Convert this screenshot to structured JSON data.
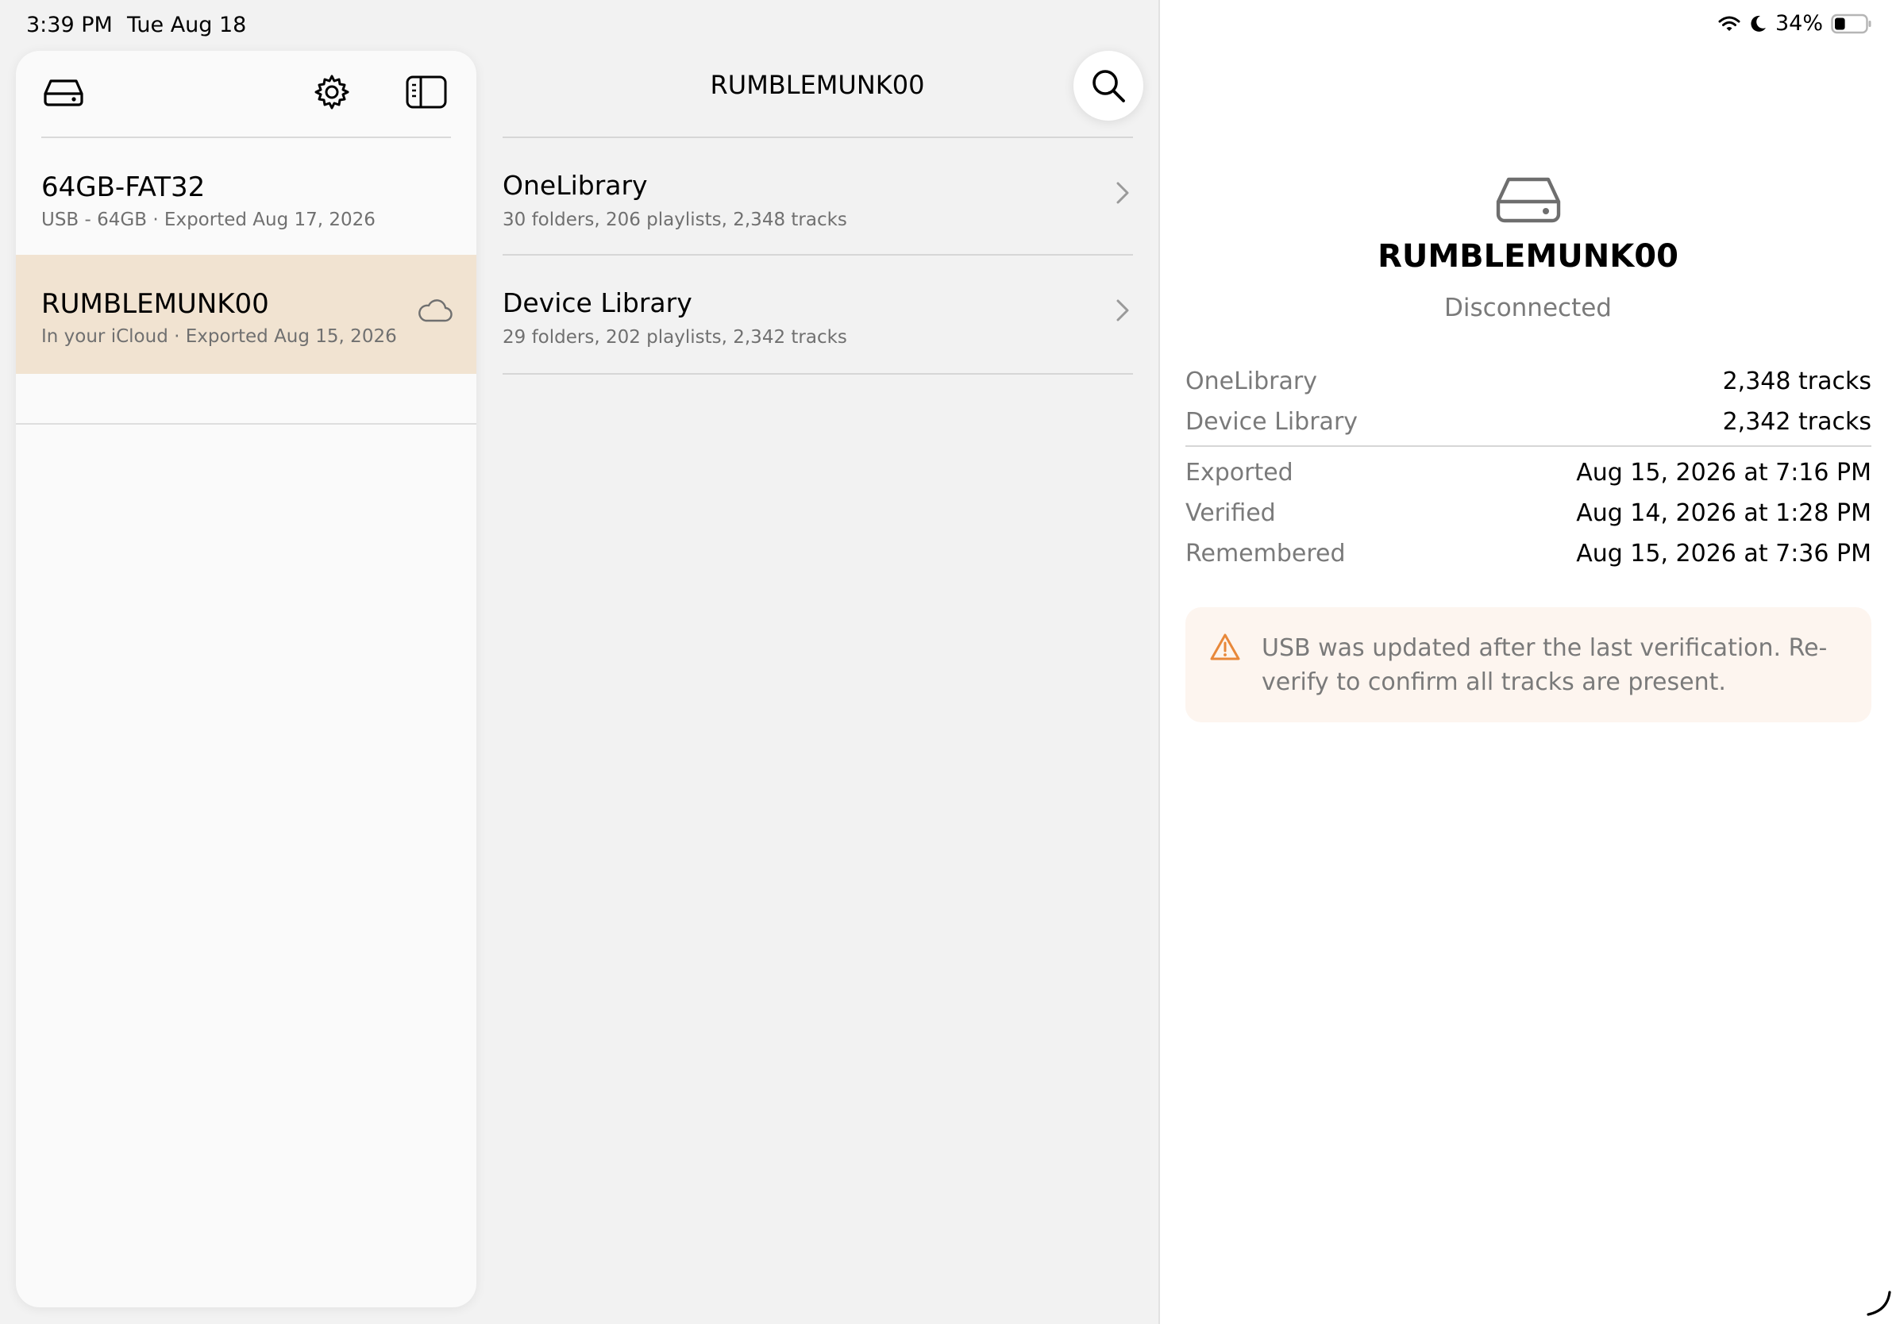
{
  "status_bar": {
    "time": "3:39 PM",
    "date": "Tue Aug 18",
    "battery": "34%",
    "battery_level": 0.34
  },
  "sidebar": {
    "devices": [
      {
        "name": "64GB-FAT32",
        "subtitle": "USB - 64GB · Exported Aug 17, 2026",
        "selected": false
      },
      {
        "name": "RUMBLEMUNK00",
        "subtitle": "In your iCloud · Exported Aug 15, 2026",
        "selected": true,
        "icon": "cloud-icon"
      }
    ]
  },
  "content": {
    "title": "RUMBLEMUNK00",
    "libraries": [
      {
        "name": "OneLibrary",
        "subtitle": "30 folders, 206 playlists, 2,348 tracks"
      },
      {
        "name": "Device Library",
        "subtitle": "29 folders, 202 playlists, 2,342 tracks"
      }
    ]
  },
  "detail": {
    "title": "RUMBLEMUNK00",
    "status": "Disconnected",
    "libraries": [
      {
        "label": "OneLibrary",
        "value": "2,348 tracks"
      },
      {
        "label": "Device Library",
        "value": "2,342 tracks"
      }
    ],
    "dates": [
      {
        "label": "Exported",
        "value": "Aug 15, 2026 at 7:16 PM"
      },
      {
        "label": "Verified",
        "value": "Aug 14, 2026 at 1:28 PM"
      },
      {
        "label": "Remembered",
        "value": "Aug 15, 2026 at 7:36 PM"
      }
    ],
    "warning": "USB was updated after the last verification. Re-verify to confirm all tracks are present."
  },
  "colors": {
    "selected_row": "#f1e3d1",
    "warning_bg": "#fdf5ef",
    "warning_icon": "#e8883a"
  }
}
